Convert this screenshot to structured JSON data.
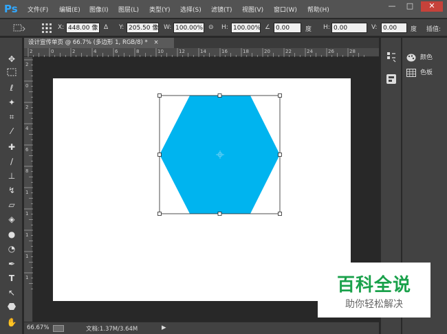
{
  "app": {
    "logo": "Ps"
  },
  "menu": [
    {
      "label": "文件(F)"
    },
    {
      "label": "编辑(E)"
    },
    {
      "label": "图像(I)"
    },
    {
      "label": "图层(L)"
    },
    {
      "label": "类型(Y)"
    },
    {
      "label": "选择(S)"
    },
    {
      "label": "滤镜(T)"
    },
    {
      "label": "视图(V)"
    },
    {
      "label": "窗口(W)"
    },
    {
      "label": "帮助(H)"
    }
  ],
  "window_controls": {
    "minimize": "—",
    "maximize": "□",
    "close": "✕"
  },
  "options_bar": {
    "x_label": "X:",
    "x_value": "448.00 像",
    "delta_icon": "Δ",
    "y_label": "Y:",
    "y_value": "205.50 像",
    "w_label": "W:",
    "w_value": "100.00%",
    "link_icon": "⊝",
    "h_label": "H:",
    "h_value": "100.00%",
    "angle_icon": "∠",
    "rot_value": "0.00",
    "rot_unit": "度",
    "hskew_label": "H:",
    "hskew_value": "0.00",
    "hskew_unit": "度",
    "vskew_label": "V:",
    "vskew_value": "0.00",
    "vskew_unit": "度",
    "interp_label": "插值:"
  },
  "document_tab": {
    "title": "设计宣传单页 @ 66.7% (多边形 1, RGB/8) *",
    "close": "×"
  },
  "ruler_top_ticks": [
    "2",
    "0",
    "2",
    "4",
    "6",
    "8",
    "10",
    "12",
    "14",
    "16",
    "18",
    "20",
    "22",
    "24",
    "26",
    "28"
  ],
  "ruler_left_ticks": [
    "2",
    "0",
    "2",
    "4",
    "6",
    "8",
    "1",
    "1",
    "1",
    "1",
    "1"
  ],
  "shape": {
    "fill": "#00b4ef",
    "type": "hexagon"
  },
  "status": {
    "zoom": "66.67%",
    "doc_info": "文档:1.37M/3.64M",
    "arrow": "▶"
  },
  "panels": [
    {
      "label": "颜色",
      "icon": "palette-icon"
    },
    {
      "label": "色板",
      "icon": "swatches-icon"
    }
  ],
  "watermark": {
    "title": "百科全说",
    "subtitle": "助你轻松解决"
  }
}
